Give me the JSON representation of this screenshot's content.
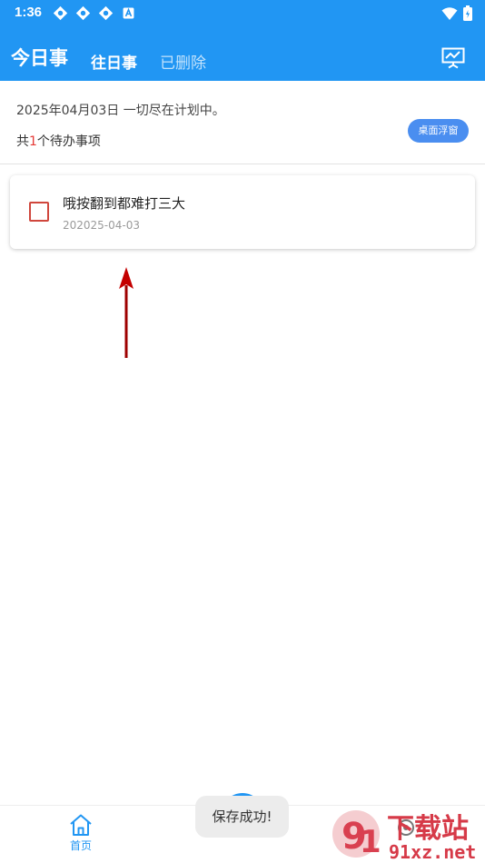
{
  "status_bar": {
    "time": "1:36",
    "left_icons": [
      "sync-icon",
      "sync-icon",
      "sync-icon",
      "font-a-icon"
    ],
    "right_icons": [
      "wifi-icon",
      "battery-icon"
    ]
  },
  "header": {
    "tabs": [
      {
        "label": "今日事",
        "active": true
      },
      {
        "label": "往日事",
        "active": false
      },
      {
        "label": "已删除",
        "active": false
      }
    ],
    "right_icon": "chart-presentation-icon"
  },
  "summary": {
    "date_line": "2025年04月03日 一切尽在计划中。",
    "count_prefix": "共",
    "count_value": "1",
    "count_suffix": "个待办事项",
    "float_button_label": "桌面浮窗"
  },
  "tasks": [
    {
      "title": "哦按翻到都难打三大",
      "date": "202025-04-03",
      "done": false
    }
  ],
  "bottom_nav": {
    "home_label": "首页",
    "home_icon": "home-icon",
    "fab_icon": "add-icon",
    "right_icon": "settings-icon"
  },
  "toast": "保存成功!",
  "watermark": {
    "brand": "下载站",
    "site": "91xz.net"
  },
  "colors": {
    "primary": "#2196F3",
    "accent_red": "#e53935",
    "checkbox_border": "#d0473d",
    "float_button": "#4a8ef0"
  }
}
